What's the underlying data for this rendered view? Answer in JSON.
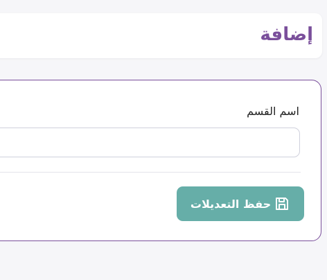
{
  "header": {
    "title": "إضافة"
  },
  "form": {
    "field_label": "اسم القسم",
    "field_value": "",
    "field_placeholder": "",
    "save_label": "حفظ التعديلات",
    "save_icon": "save-icon"
  },
  "colors": {
    "accent": "#7a4f9b",
    "save_button": "#66aea8",
    "background": "#f6f6f9"
  }
}
